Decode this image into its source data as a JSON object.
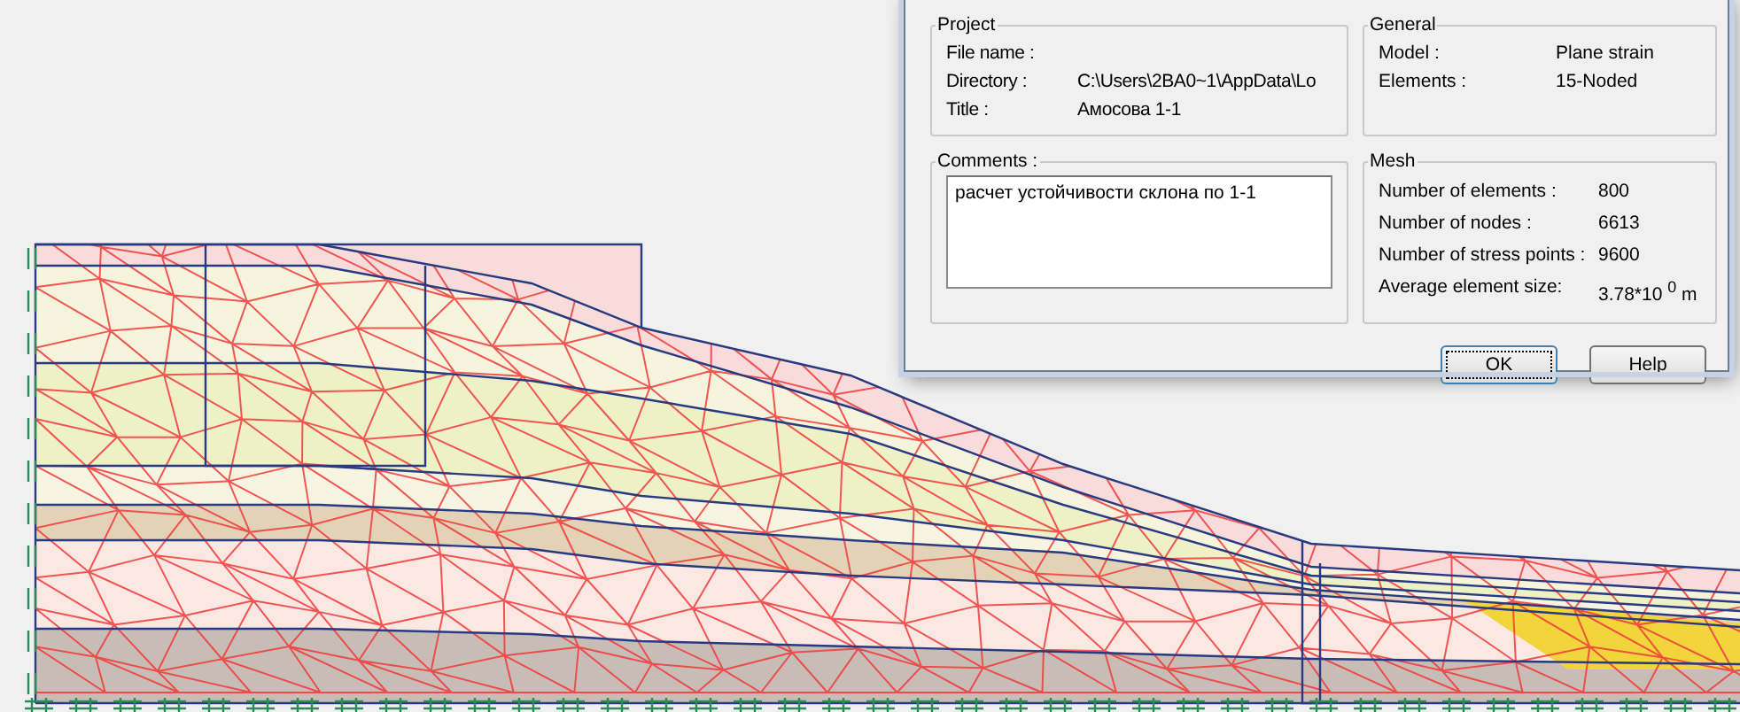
{
  "dialog": {
    "project": {
      "title": "Project",
      "fields": [
        {
          "label": "File name :"
        },
        {
          "label": "Directory :",
          "value": "C:\\Users\\2BA0~1\\AppData\\Lo"
        },
        {
          "label": "Title :",
          "value": "Амосова 1-1"
        }
      ]
    },
    "general": {
      "title": "General",
      "fields": [
        {
          "label": "Model :",
          "value": "Plane strain"
        },
        {
          "label": "Elements :",
          "value": "15-Noded"
        }
      ]
    },
    "comments": {
      "title": "Comments :",
      "value": "расчет устойчивости склона по 1-1"
    },
    "mesh": {
      "title": "Mesh",
      "fields": [
        {
          "label": "Number of elements :",
          "value": "800"
        },
        {
          "label": "Number of nodes :",
          "value": "6613"
        },
        {
          "label": "Number of stress points :",
          "value": "9600"
        },
        {
          "label": "Average element size:",
          "value": "3.78*10 $^{0}$ m"
        }
      ]
    },
    "buttons": [
      {
        "label": "OK",
        "default": true
      },
      {
        "label": "Help",
        "default": false
      }
    ]
  }
}
